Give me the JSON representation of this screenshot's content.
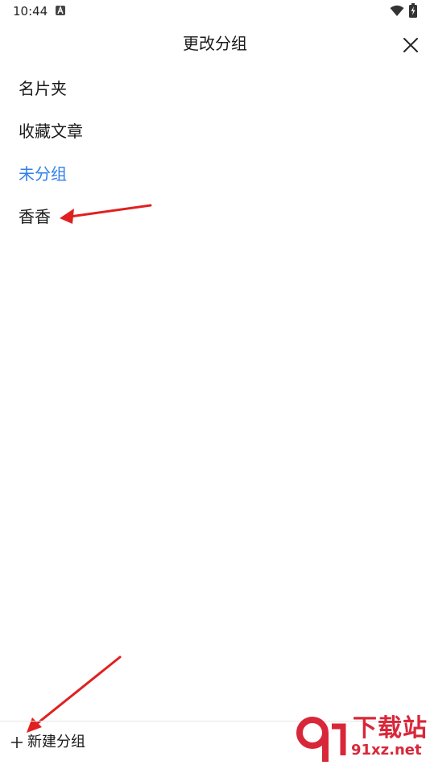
{
  "status_bar": {
    "time": "10:44"
  },
  "header": {
    "title": "更改分组",
    "close_icon": "close-icon"
  },
  "groups": [
    {
      "label": "名片夹",
      "selected": false
    },
    {
      "label": "收藏文章",
      "selected": false
    },
    {
      "label": "未分组",
      "selected": true
    },
    {
      "label": "香香",
      "selected": false
    }
  ],
  "footer": {
    "new_group_label": "新建分组",
    "plus_icon": "plus-icon"
  },
  "watermark": {
    "title": "下载站",
    "url": "91xz.net"
  },
  "colors": {
    "selected_text": "#2f80ed",
    "annotation_arrow": "#e02020",
    "watermark": "#d9273a"
  }
}
